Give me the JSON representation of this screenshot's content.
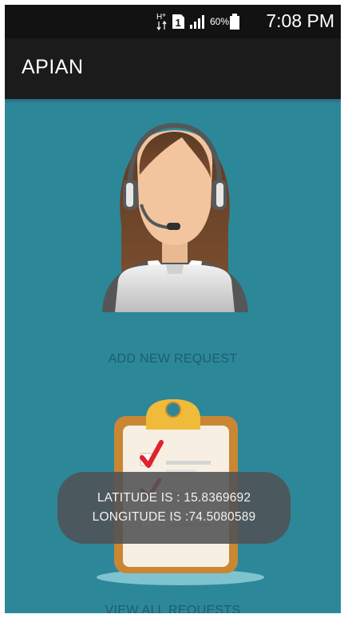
{
  "status_bar": {
    "battery_percent": "60%",
    "time": "7:08 PM",
    "icons": [
      "hplus-network-icon",
      "sim-1-icon",
      "signal-icon",
      "battery-icon"
    ]
  },
  "app_bar": {
    "title": "APIAN"
  },
  "actions": [
    {
      "label": "ADD NEW REQUEST",
      "icon": "customer-support-icon"
    },
    {
      "label": "VIEW ALL REQUESTS",
      "icon": "clipboard-checklist-icon"
    }
  ],
  "toast": {
    "latitude_text": "LATITUDE IS : 15.8369692",
    "longitude_text": "LONGITUDE IS :74.5080589"
  },
  "colors": {
    "background": "#2c8799",
    "status_bar": "#121212",
    "app_bar": "#1b1b1b",
    "toast": "#505254",
    "label": "#1e5e6b"
  }
}
